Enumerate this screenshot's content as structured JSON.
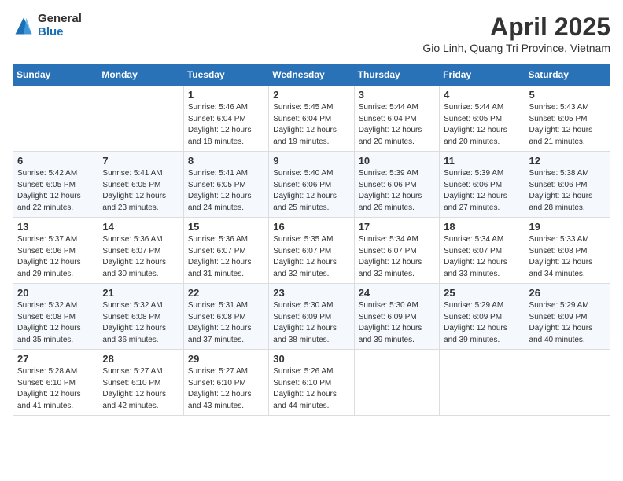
{
  "header": {
    "logo_general": "General",
    "logo_blue": "Blue",
    "title": "April 2025",
    "subtitle": "Gio Linh, Quang Tri Province, Vietnam"
  },
  "calendar": {
    "days_of_week": [
      "Sunday",
      "Monday",
      "Tuesday",
      "Wednesday",
      "Thursday",
      "Friday",
      "Saturday"
    ],
    "weeks": [
      [
        {
          "day": "",
          "content": ""
        },
        {
          "day": "",
          "content": ""
        },
        {
          "day": "1",
          "content": "Sunrise: 5:46 AM\nSunset: 6:04 PM\nDaylight: 12 hours\nand 18 minutes."
        },
        {
          "day": "2",
          "content": "Sunrise: 5:45 AM\nSunset: 6:04 PM\nDaylight: 12 hours\nand 19 minutes."
        },
        {
          "day": "3",
          "content": "Sunrise: 5:44 AM\nSunset: 6:04 PM\nDaylight: 12 hours\nand 20 minutes."
        },
        {
          "day": "4",
          "content": "Sunrise: 5:44 AM\nSunset: 6:05 PM\nDaylight: 12 hours\nand 20 minutes."
        },
        {
          "day": "5",
          "content": "Sunrise: 5:43 AM\nSunset: 6:05 PM\nDaylight: 12 hours\nand 21 minutes."
        }
      ],
      [
        {
          "day": "6",
          "content": "Sunrise: 5:42 AM\nSunset: 6:05 PM\nDaylight: 12 hours\nand 22 minutes."
        },
        {
          "day": "7",
          "content": "Sunrise: 5:41 AM\nSunset: 6:05 PM\nDaylight: 12 hours\nand 23 minutes."
        },
        {
          "day": "8",
          "content": "Sunrise: 5:41 AM\nSunset: 6:05 PM\nDaylight: 12 hours\nand 24 minutes."
        },
        {
          "day": "9",
          "content": "Sunrise: 5:40 AM\nSunset: 6:06 PM\nDaylight: 12 hours\nand 25 minutes."
        },
        {
          "day": "10",
          "content": "Sunrise: 5:39 AM\nSunset: 6:06 PM\nDaylight: 12 hours\nand 26 minutes."
        },
        {
          "day": "11",
          "content": "Sunrise: 5:39 AM\nSunset: 6:06 PM\nDaylight: 12 hours\nand 27 minutes."
        },
        {
          "day": "12",
          "content": "Sunrise: 5:38 AM\nSunset: 6:06 PM\nDaylight: 12 hours\nand 28 minutes."
        }
      ],
      [
        {
          "day": "13",
          "content": "Sunrise: 5:37 AM\nSunset: 6:06 PM\nDaylight: 12 hours\nand 29 minutes."
        },
        {
          "day": "14",
          "content": "Sunrise: 5:36 AM\nSunset: 6:07 PM\nDaylight: 12 hours\nand 30 minutes."
        },
        {
          "day": "15",
          "content": "Sunrise: 5:36 AM\nSunset: 6:07 PM\nDaylight: 12 hours\nand 31 minutes."
        },
        {
          "day": "16",
          "content": "Sunrise: 5:35 AM\nSunset: 6:07 PM\nDaylight: 12 hours\nand 32 minutes."
        },
        {
          "day": "17",
          "content": "Sunrise: 5:34 AM\nSunset: 6:07 PM\nDaylight: 12 hours\nand 32 minutes."
        },
        {
          "day": "18",
          "content": "Sunrise: 5:34 AM\nSunset: 6:07 PM\nDaylight: 12 hours\nand 33 minutes."
        },
        {
          "day": "19",
          "content": "Sunrise: 5:33 AM\nSunset: 6:08 PM\nDaylight: 12 hours\nand 34 minutes."
        }
      ],
      [
        {
          "day": "20",
          "content": "Sunrise: 5:32 AM\nSunset: 6:08 PM\nDaylight: 12 hours\nand 35 minutes."
        },
        {
          "day": "21",
          "content": "Sunrise: 5:32 AM\nSunset: 6:08 PM\nDaylight: 12 hours\nand 36 minutes."
        },
        {
          "day": "22",
          "content": "Sunrise: 5:31 AM\nSunset: 6:08 PM\nDaylight: 12 hours\nand 37 minutes."
        },
        {
          "day": "23",
          "content": "Sunrise: 5:30 AM\nSunset: 6:09 PM\nDaylight: 12 hours\nand 38 minutes."
        },
        {
          "day": "24",
          "content": "Sunrise: 5:30 AM\nSunset: 6:09 PM\nDaylight: 12 hours\nand 39 minutes."
        },
        {
          "day": "25",
          "content": "Sunrise: 5:29 AM\nSunset: 6:09 PM\nDaylight: 12 hours\nand 39 minutes."
        },
        {
          "day": "26",
          "content": "Sunrise: 5:29 AM\nSunset: 6:09 PM\nDaylight: 12 hours\nand 40 minutes."
        }
      ],
      [
        {
          "day": "27",
          "content": "Sunrise: 5:28 AM\nSunset: 6:10 PM\nDaylight: 12 hours\nand 41 minutes."
        },
        {
          "day": "28",
          "content": "Sunrise: 5:27 AM\nSunset: 6:10 PM\nDaylight: 12 hours\nand 42 minutes."
        },
        {
          "day": "29",
          "content": "Sunrise: 5:27 AM\nSunset: 6:10 PM\nDaylight: 12 hours\nand 43 minutes."
        },
        {
          "day": "30",
          "content": "Sunrise: 5:26 AM\nSunset: 6:10 PM\nDaylight: 12 hours\nand 44 minutes."
        },
        {
          "day": "",
          "content": ""
        },
        {
          "day": "",
          "content": ""
        },
        {
          "day": "",
          "content": ""
        }
      ]
    ]
  }
}
